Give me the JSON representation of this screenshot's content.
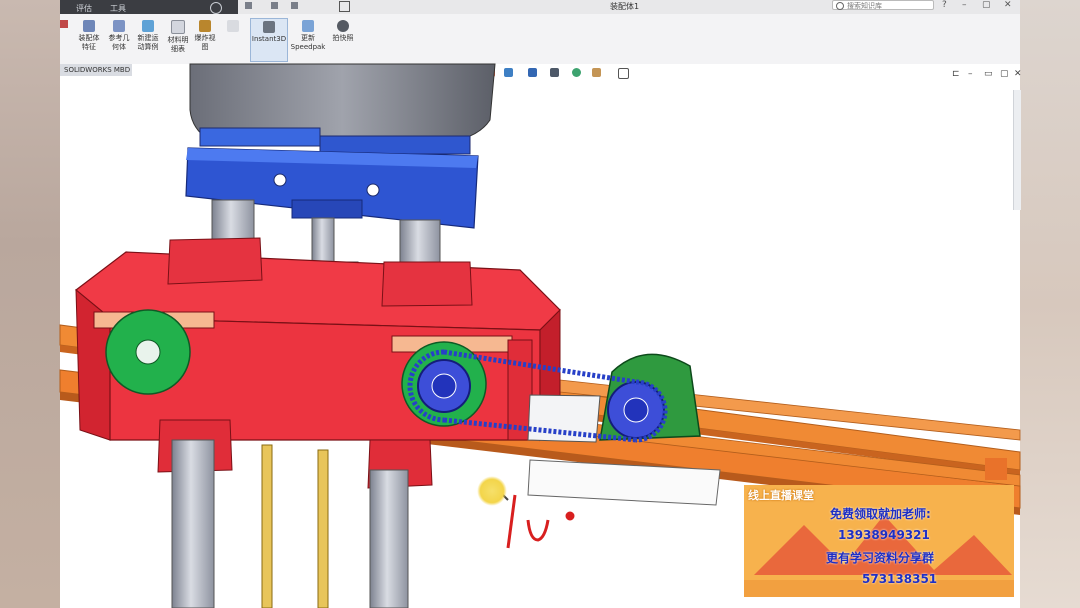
{
  "app": {
    "tabs": [
      "评估",
      "工具"
    ],
    "doc_title": "装配体1",
    "search_placeholder": "搜索知识库"
  },
  "ribbon": {
    "buttons": [
      {
        "label": "装配体\n特征"
      },
      {
        "label": "参考几\n何体"
      },
      {
        "label": "新建运\n动算例"
      },
      {
        "label": "材料明\n细表"
      },
      {
        "label": "爆炸视\n图"
      },
      {
        "label": "Instant3D"
      },
      {
        "label": "更新\nSpeedpak"
      },
      {
        "label": "拍快照"
      }
    ]
  },
  "feature_tab": "SOLIDWORKS MBD",
  "promo": {
    "heading": "线上直播课堂",
    "line1": "免费领取就加老师:",
    "line2": "13938949321",
    "line3": "更有学习资料分享群",
    "line4": "573138351"
  },
  "colors": {
    "frame_red": "#f03a46",
    "bracket_blue": "#2e55d2",
    "gear_green": "#22b14c",
    "rail_orange": "#ef8a34",
    "shaft_gray": "#a9aebb",
    "promo_orange": "#f7b24d"
  }
}
